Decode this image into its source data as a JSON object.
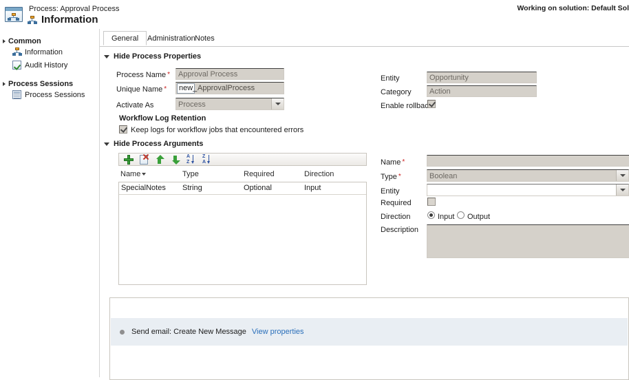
{
  "titlebar": {
    "subtitle": "Process: Approval Process",
    "title": "Information",
    "solution_status": "Working on solution: Default Sol",
    "process_icon": "process-icon",
    "title_icon": "process-node-icon"
  },
  "sidebar": {
    "groups": [
      {
        "label": "Common",
        "items": [
          {
            "label": "Information",
            "icon": "process-node-icon"
          },
          {
            "label": "Audit History",
            "icon": "audit-check-icon"
          }
        ]
      },
      {
        "label": "Process Sessions",
        "items": [
          {
            "label": "Process Sessions",
            "icon": "grid-window-icon"
          }
        ]
      }
    ]
  },
  "tabs": [
    {
      "label": "General",
      "active": true
    },
    {
      "label": "Administration",
      "active": false
    },
    {
      "label": "Notes",
      "active": false
    }
  ],
  "process_properties": {
    "section_label": "Hide Process Properties",
    "fields": {
      "process_name_label": "Process Name",
      "process_name_value": "Approval Process",
      "unique_name_label": "Unique Name",
      "unique_name_prefix": "new_",
      "unique_name_value": "ApprovalProcess",
      "activate_as_label": "Activate As",
      "activate_as_value": "Process",
      "entity_label": "Entity",
      "entity_value": "Opportunity",
      "category_label": "Category",
      "category_value": "Action",
      "enable_rollback_label": "Enable rollback",
      "enable_rollback_checked": true
    },
    "log_retention": {
      "header": "Workflow Log Retention",
      "checkbox_label": "Keep logs for workflow jobs that encountered errors",
      "checked": true
    }
  },
  "process_arguments": {
    "section_label": "Hide Process Arguments",
    "toolbar": [
      {
        "name": "add-argument-button",
        "icon": "plus-icon"
      },
      {
        "name": "delete-argument-button",
        "icon": "delete-icon"
      },
      {
        "name": "move-up-button",
        "icon": "arrow-up-icon"
      },
      {
        "name": "move-down-button",
        "icon": "arrow-down-icon"
      },
      {
        "name": "sort-ascending-button",
        "icon": "sort-az-icon"
      },
      {
        "name": "sort-descending-button",
        "icon": "sort-za-icon"
      }
    ],
    "columns": [
      "Name",
      "Type",
      "Required",
      "Direction"
    ],
    "sorted_column": "Name",
    "rows": [
      {
        "name": "SpecialNotes",
        "type": "String",
        "required": "Optional",
        "direction": "Input"
      }
    ],
    "detail": {
      "name_label": "Name",
      "name_value": "",
      "type_label": "Type",
      "type_value": "Boolean",
      "entity_label": "Entity",
      "entity_value": "",
      "required_label": "Required",
      "required_checked": false,
      "direction_label": "Direction",
      "direction_input_label": "Input",
      "direction_output_label": "Output",
      "direction_selected": "Input",
      "description_label": "Description",
      "description_value": ""
    }
  },
  "steps_panel": {
    "rows": [
      {
        "text": "Send email: Create New Message",
        "link": "View properties"
      }
    ]
  }
}
